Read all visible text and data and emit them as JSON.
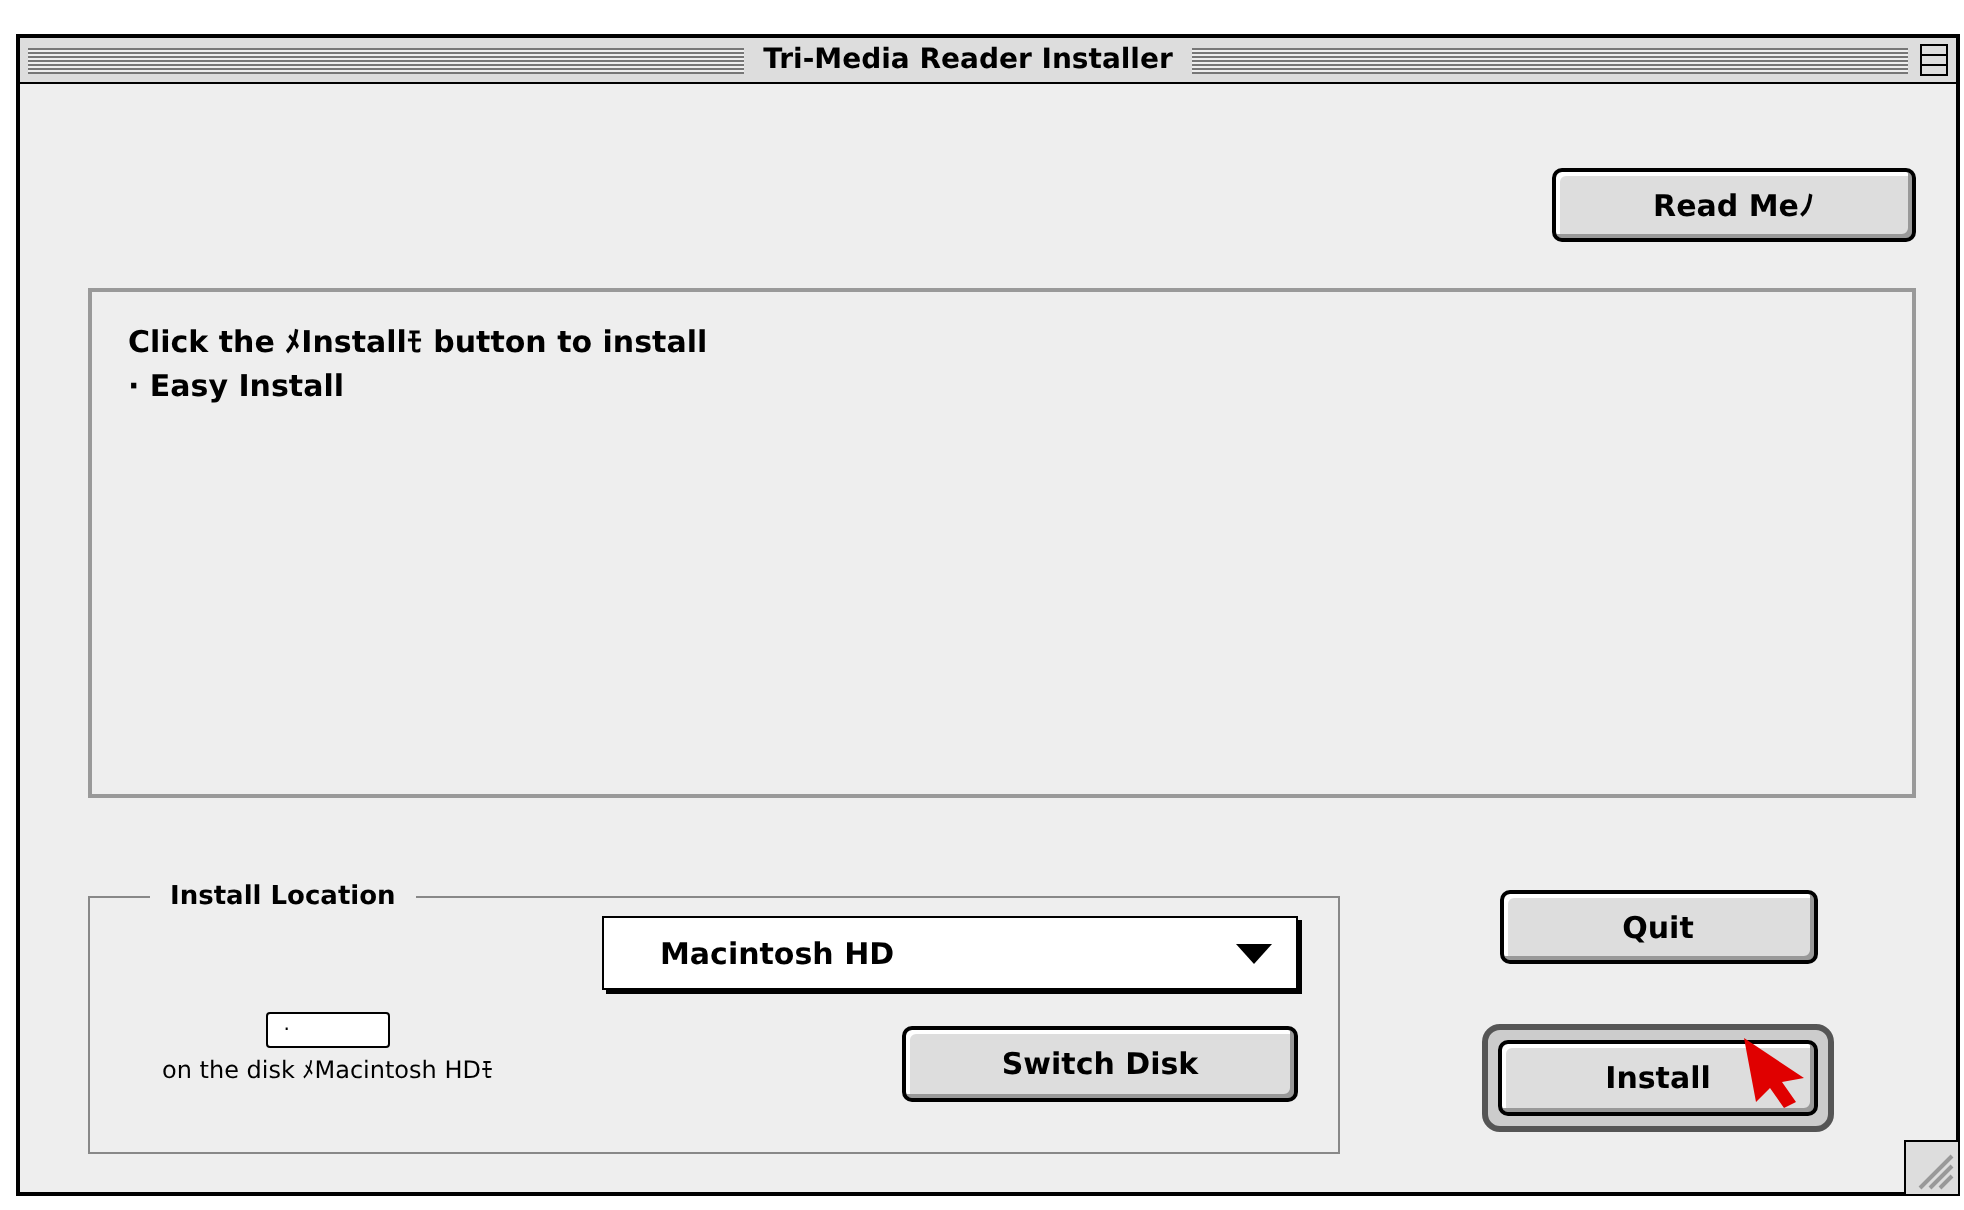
{
  "window": {
    "title": "Tri-Media Reader Installer"
  },
  "read_me_button": {
    "label": "Read Meﾉ"
  },
  "message": {
    "lines": [
      "Click the ﾒInstallﾓ button to install",
      "· Easy Install"
    ]
  },
  "install_location": {
    "label": "Install Location",
    "disk_menu": {
      "value": "Macintosh HD"
    },
    "disk_field": {
      "value": "."
    },
    "caption": "on the disk ﾒMacintosh HDﾓ",
    "switch_button": {
      "label": "Switch Disk"
    }
  },
  "quit_button": {
    "label": "Quit"
  },
  "install_button": {
    "label": "Install",
    "default": true
  }
}
